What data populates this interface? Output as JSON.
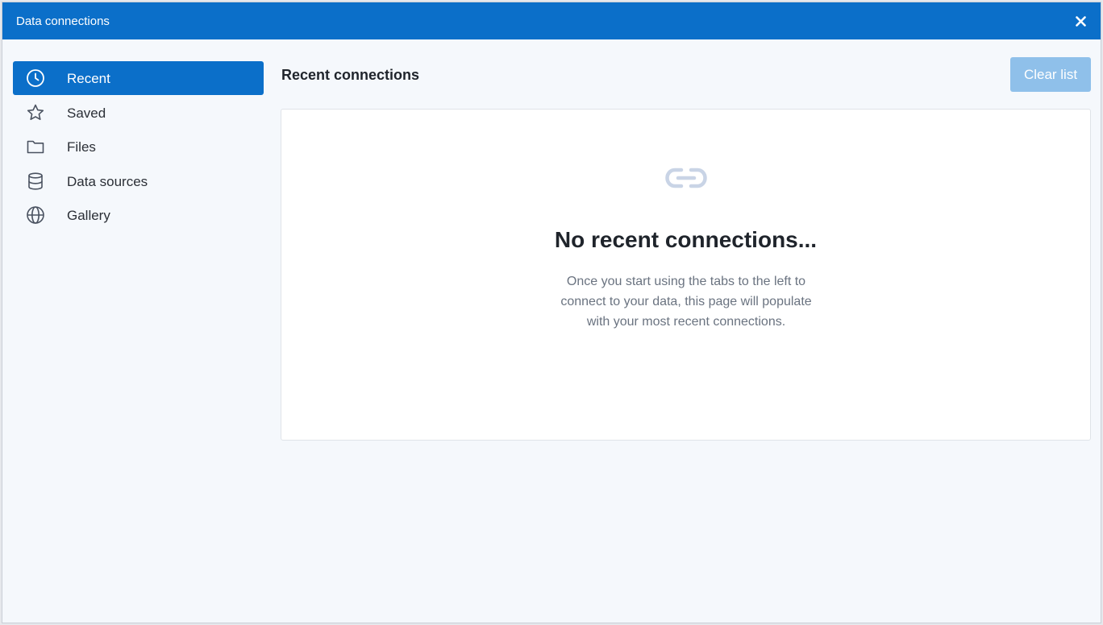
{
  "window": {
    "title": "Data connections",
    "accent_color": "#0b6fc9"
  },
  "sidebar": {
    "items": [
      {
        "label": "Recent",
        "icon": "clock-icon",
        "active": true
      },
      {
        "label": "Saved",
        "icon": "star-icon",
        "active": false
      },
      {
        "label": "Files",
        "icon": "folder-icon",
        "active": false
      },
      {
        "label": "Data sources",
        "icon": "database-icon",
        "active": false
      },
      {
        "label": "Gallery",
        "icon": "globe-icon",
        "active": false
      }
    ]
  },
  "main": {
    "title": "Recent connections",
    "clear_button_label": "Clear list",
    "empty_state": {
      "icon": "link-icon",
      "heading": "No recent connections...",
      "body": "Once you start using the tabs to the left to connect to your data, this page will populate with your most recent connections."
    }
  }
}
